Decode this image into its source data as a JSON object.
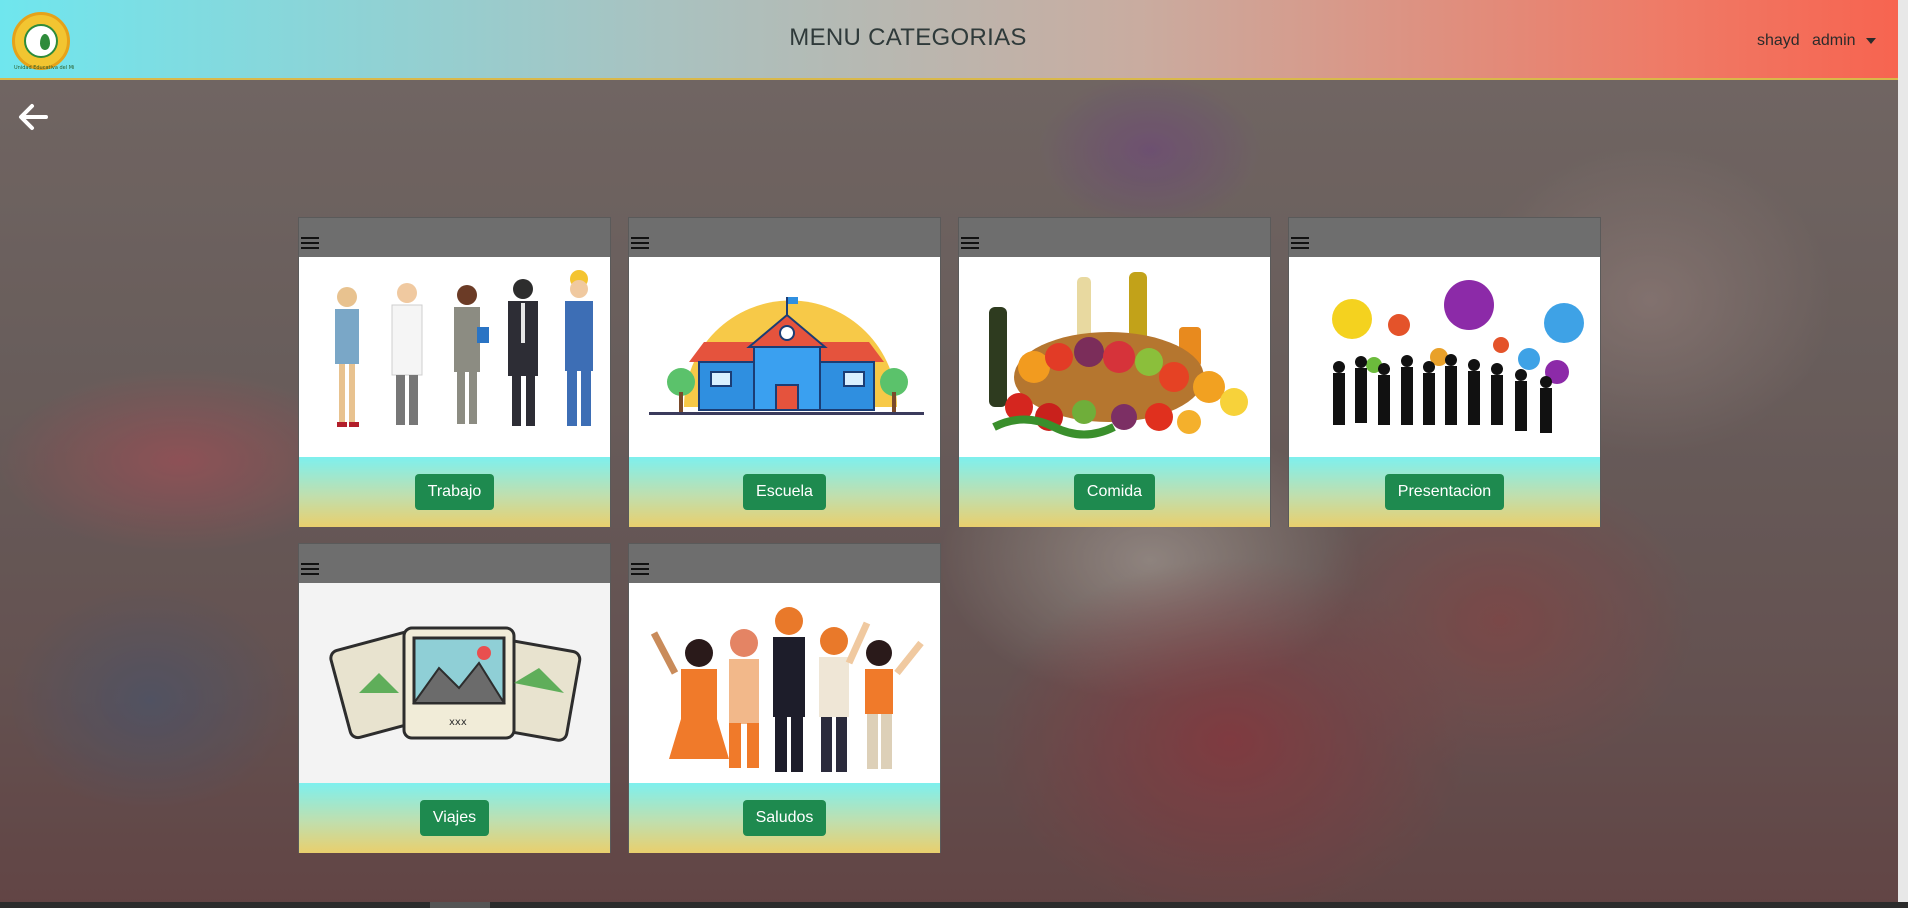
{
  "header": {
    "title": "MENU CATEGORIAS",
    "user_name": "shayd",
    "user_menu_label": "admin",
    "logo_icon": "school-logo-icon",
    "logo_text": "Unidad Educativa del Milenio"
  },
  "nav": {
    "back_icon": "arrow-left-icon"
  },
  "categories": [
    {
      "label": "Trabajo",
      "image_icon": "workers-illustration",
      "menu_icon": "hamburger-menu-icon"
    },
    {
      "label": "Escuela",
      "image_icon": "school-building-illustration",
      "menu_icon": "hamburger-menu-icon"
    },
    {
      "label": "Comida",
      "image_icon": "food-basket-illustration",
      "menu_icon": "hamburger-menu-icon"
    },
    {
      "label": "Presentacion",
      "image_icon": "people-speech-bubbles-illustration",
      "menu_icon": "hamburger-menu-icon"
    },
    {
      "label": "Viajes",
      "image_icon": "travel-photos-illustration",
      "menu_icon": "hamburger-menu-icon"
    },
    {
      "label": "Saludos",
      "image_icon": "waving-friends-illustration",
      "menu_icon": "hamburger-menu-icon"
    }
  ],
  "colors": {
    "button": "#1e8a4f",
    "header_left": "#6fe6ee",
    "header_right": "#f76450"
  }
}
